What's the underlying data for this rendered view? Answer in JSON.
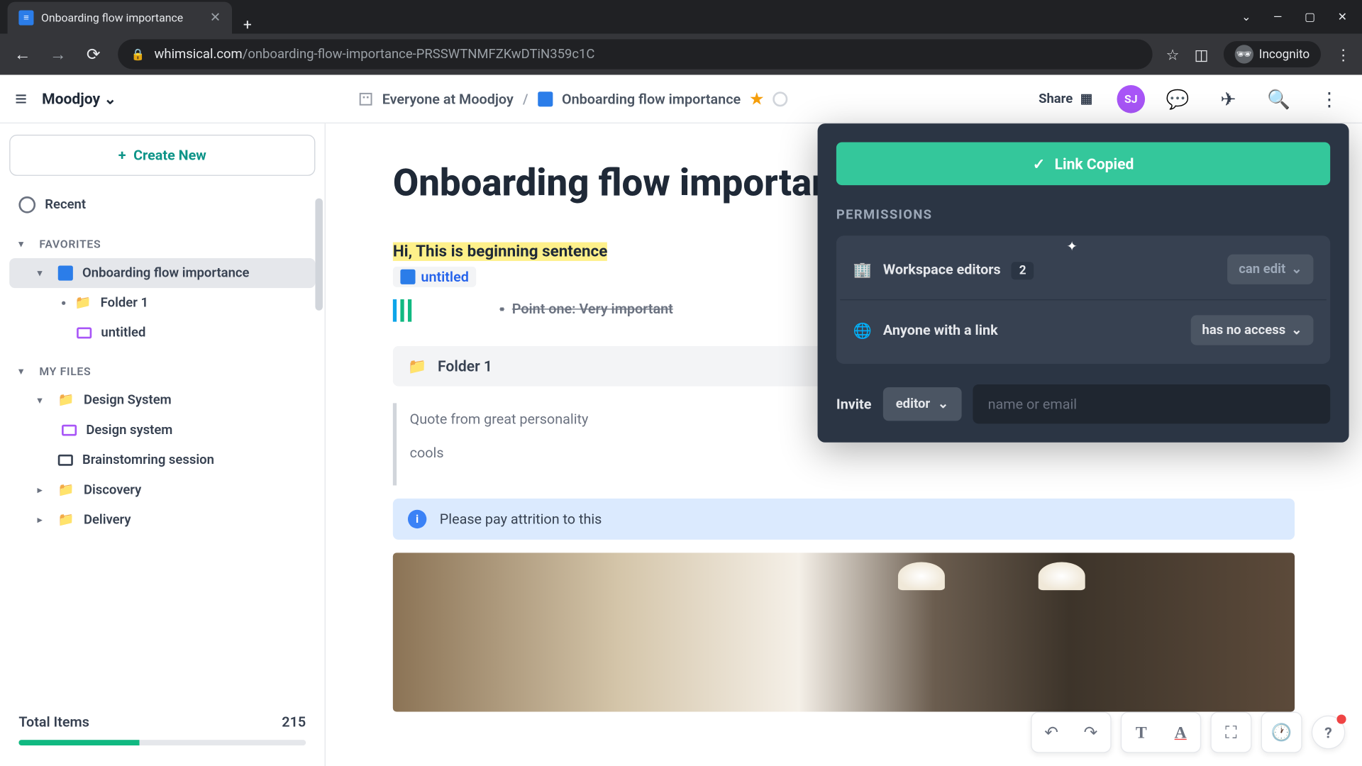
{
  "browser": {
    "tab_title": "Onboarding flow importance",
    "url_domain": "whimsical.com",
    "url_path": "/onboarding-flow-importance-PRSSWTNMFZKwDTiN359c1C",
    "incognito_label": "Incognito"
  },
  "header": {
    "workspace": "Moodjoy",
    "breadcrumb_root": "Everyone at Moodjoy",
    "breadcrumb_doc": "Onboarding flow importance",
    "share_label": "Share",
    "avatar_initials": "SJ"
  },
  "sidebar": {
    "create_label": "Create New",
    "recent_label": "Recent",
    "favorites_label": "FAVORITES",
    "myfiles_label": "MY FILES",
    "fav_items": [
      {
        "label": "Onboarding flow importance"
      },
      {
        "label": "Folder 1"
      },
      {
        "label": "untitled"
      }
    ],
    "my_items": [
      {
        "label": "Design System"
      },
      {
        "label": "Design system"
      },
      {
        "label": "Brainstomring session"
      },
      {
        "label": "Discovery"
      },
      {
        "label": "Delivery"
      }
    ],
    "total_label": "Total Items",
    "total_value": "215"
  },
  "document": {
    "title": "Onboarding flow importance",
    "highlight_line": "Hi, This is beginning sentence",
    "inline_doc_label": "untitled",
    "strike_point": "Point one: Very important",
    "folder_card": "Folder 1",
    "quote_line1": "Quote from great personality",
    "quote_line2": "cools",
    "callout_text": "Please pay attrition to this"
  },
  "share_popover": {
    "copied_label": "Link Copied",
    "permissions_label": "PERMISSIONS",
    "row1_label": "Workspace editors",
    "row1_count": "2",
    "row1_access": "can edit",
    "row2_label": "Anyone with a link",
    "row2_access": "has no access",
    "invite_label": "Invite",
    "invite_role": "editor",
    "invite_placeholder": "name or email"
  }
}
